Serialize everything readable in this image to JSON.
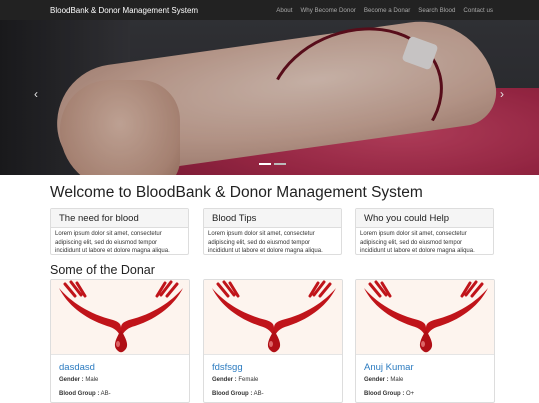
{
  "navbar": {
    "brand": "BloodBank & Donor Management System",
    "items": [
      "About",
      "Why Become Donor",
      "Become a Donar",
      "Search Blood",
      "Contact us"
    ]
  },
  "carousel": {
    "prev": "‹",
    "next": "›",
    "active_slide": 1,
    "slide_count": 2
  },
  "welcome": {
    "title": "Welcome to BloodBank & Donor Management System"
  },
  "panels": [
    {
      "title": "The need for blood",
      "body": "Lorem ipsum dolor sit amet, consectetur adipiscing elit, sed do eiusmod tempor incididunt ut labore et dolore magna aliqua."
    },
    {
      "title": "Blood Tips",
      "body": "Lorem ipsum dolor sit amet, consectetur adipiscing elit, sed do eiusmod tempor incididunt ut labore et dolore magna aliqua."
    },
    {
      "title": "Who you could Help",
      "body": "Lorem ipsum dolor sit amet, consectetur adipiscing elit, sed do eiusmod tempor incididunt ut labore et dolore magna aliqua."
    }
  ],
  "donors_section": {
    "title": "Some of the Donar"
  },
  "donors": [
    {
      "name": "dasdasd",
      "gender_label": "Gender :",
      "gender": "Male",
      "blood_label": "Blood Group :",
      "blood": "AB-"
    },
    {
      "name": "fdsfsgg",
      "gender_label": "Gender :",
      "gender": "Female",
      "blood_label": "Blood Group :",
      "blood": "AB-"
    },
    {
      "name": "Anuj Kumar",
      "gender_label": "Gender :",
      "gender": "Male",
      "blood_label": "Blood Group :",
      "blood": "O+"
    }
  ],
  "colors": {
    "navbar_bg": "#222222",
    "link": "#2b7bc0",
    "blood_red": "#c0141a"
  },
  "icons": {
    "carousel_prev": "chevron-left-icon",
    "carousel_next": "chevron-right-icon",
    "donor_image": "blood-donation-hands-image"
  }
}
